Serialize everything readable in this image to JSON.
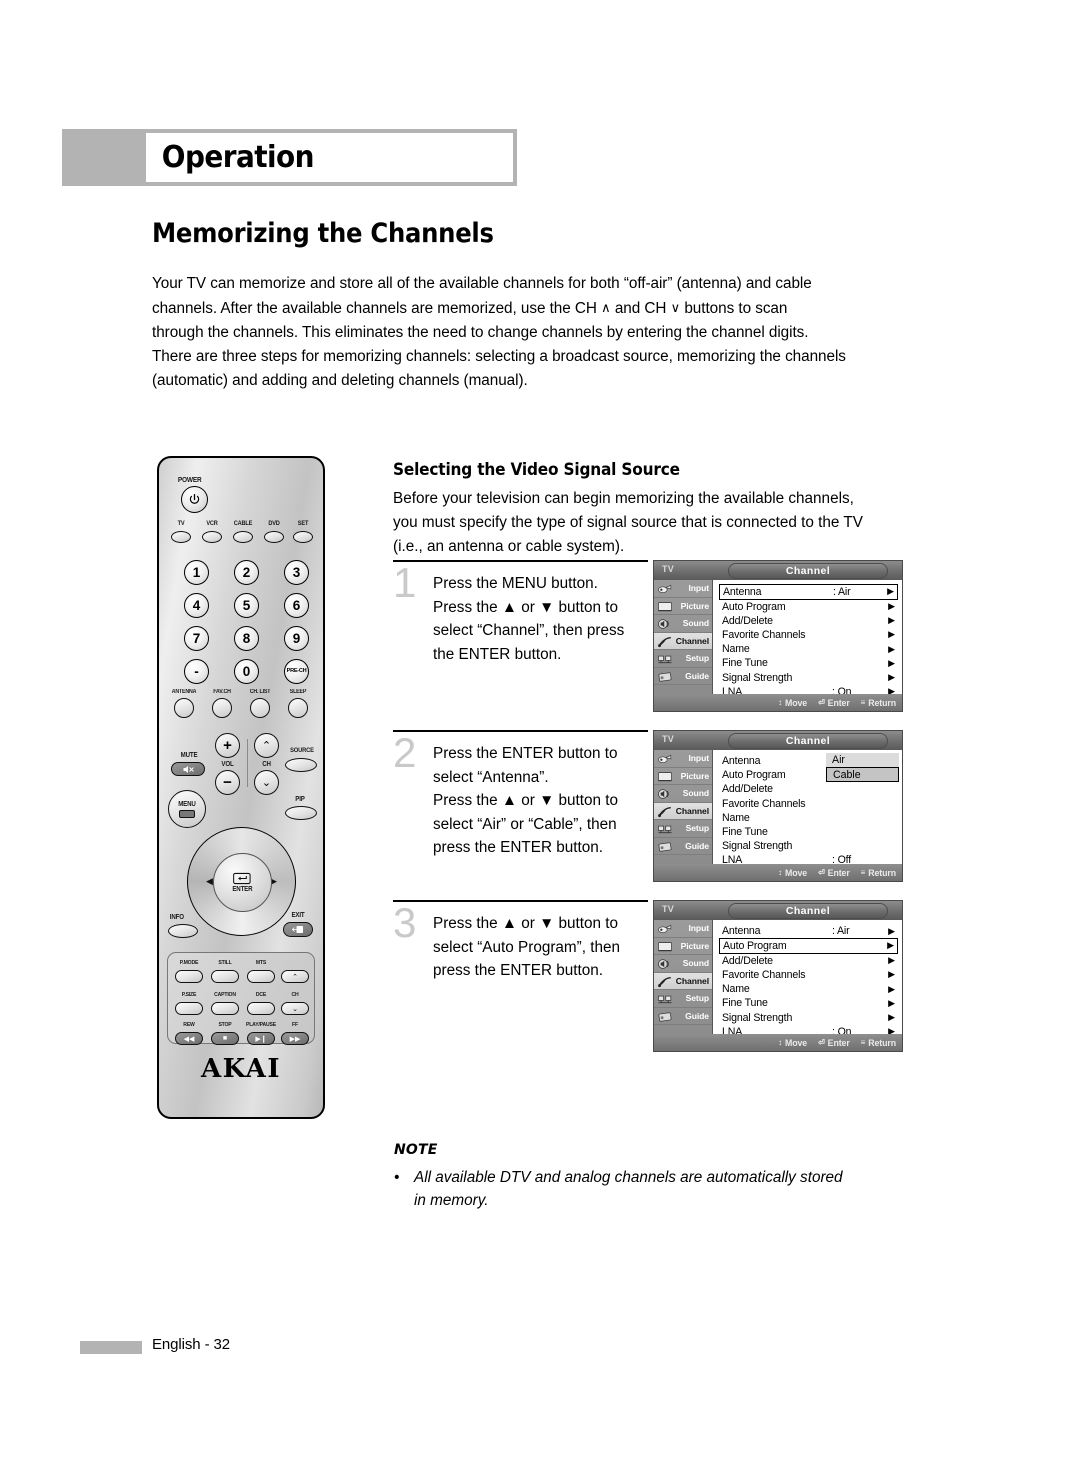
{
  "header": {
    "title": "Operation"
  },
  "page_title": "Memorizing the Channels",
  "intro": {
    "l1": "Your TV can memorize and store all of the available channels for both “off-air” (antenna) and cable",
    "l2a": "channels. After the available channels are memorized, use the CH",
    "l2b": "and CH",
    "l2c": "buttons to scan",
    "l3": "through the channels. This eliminates the need to change channels by entering the channel digits.",
    "l4": "There are three steps for memorizing channels: selecting a broadcast source, memorizing the channels",
    "l5": "(automatic) and adding and deleting channels (manual).",
    "ch_up_glyph": "∧",
    "ch_down_glyph": "∨"
  },
  "section": {
    "title": "Selecting the Video Signal Source",
    "lead_l1": "Before your television can begin memorizing the available channels,",
    "lead_l2": "you must specify the type of signal source that is connected to the TV",
    "lead_l3": "(i.e., an antenna or cable system)."
  },
  "steps": [
    {
      "number": "1",
      "lines": [
        "Press the MENU button.",
        "Press the ▲ or ▼ button to",
        "select “Channel”, then press",
        "the ENTER button."
      ]
    },
    {
      "number": "2",
      "lines": [
        "Press the ENTER button to",
        "select “Antenna”.",
        "Press the ▲ or ▼ button to",
        "select “Air” or “Cable”, then",
        "press the ENTER button."
      ]
    },
    {
      "number": "3",
      "lines": [
        "Press the ▲ or ▼ button to",
        "select “Auto Program”, then",
        "press the ENTER button."
      ]
    }
  ],
  "osd": {
    "source_label": "TV",
    "menu_title": "Channel",
    "sidebar": [
      {
        "label": "Input",
        "icon": "input-icon",
        "selected": false
      },
      {
        "label": "Picture",
        "icon": "picture-icon",
        "selected": false
      },
      {
        "label": "Sound",
        "icon": "sound-icon",
        "selected": false
      },
      {
        "label": "Channel",
        "icon": "channel-icon",
        "selected": true
      },
      {
        "label": "Setup",
        "icon": "setup-icon",
        "selected": false
      },
      {
        "label": "Guide",
        "icon": "guide-icon",
        "selected": false
      }
    ],
    "hints": [
      {
        "glyph": "↕",
        "label": "Move",
        "icon": "updown-arrows-icon"
      },
      {
        "glyph": "⏎",
        "label": "Enter",
        "icon": "enter-key-icon"
      },
      {
        "glyph": "≡",
        "label": "Return",
        "icon": "menu-key-icon"
      }
    ],
    "arrow_glyph": "▶",
    "screens": [
      {
        "id": "screen-1",
        "rows": [
          {
            "name": "Antenna",
            "value": ": Air",
            "arrow": true,
            "highlight": true
          },
          {
            "name": "Auto Program",
            "value": "",
            "arrow": true,
            "highlight": false
          },
          {
            "name": "Add/Delete",
            "value": "",
            "arrow": true,
            "highlight": false
          },
          {
            "name": "Favorite Channels",
            "value": "",
            "arrow": true,
            "highlight": false
          },
          {
            "name": "Name",
            "value": "",
            "arrow": true,
            "highlight": false
          },
          {
            "name": "Fine Tune",
            "value": "",
            "arrow": true,
            "highlight": false
          },
          {
            "name": "Signal Strength",
            "value": "",
            "arrow": true,
            "highlight": false
          },
          {
            "name": "LNA",
            "value": ": On",
            "arrow": true,
            "highlight": false
          }
        ],
        "popup": null
      },
      {
        "id": "screen-2",
        "rows": [
          {
            "name": "Antenna",
            "value": "",
            "arrow": false,
            "highlight": false
          },
          {
            "name": "Auto Program",
            "value": "",
            "arrow": false,
            "highlight": false
          },
          {
            "name": "Add/Delete",
            "value": "",
            "arrow": false,
            "highlight": false
          },
          {
            "name": "Favorite Channels",
            "value": "",
            "arrow": false,
            "highlight": false
          },
          {
            "name": "Name",
            "value": "",
            "arrow": false,
            "highlight": false
          },
          {
            "name": "Fine Tune",
            "value": "",
            "arrow": false,
            "highlight": false
          },
          {
            "name": "Signal Strength",
            "value": "",
            "arrow": false,
            "highlight": false
          },
          {
            "name": "LNA",
            "value": ": Off",
            "arrow": false,
            "highlight": false
          }
        ],
        "popup": {
          "options": [
            "Air",
            "Cable"
          ],
          "selected": "Cable"
        }
      },
      {
        "id": "screen-3",
        "rows": [
          {
            "name": "Antenna",
            "value": ": Air",
            "arrow": true,
            "highlight": false
          },
          {
            "name": "Auto Program",
            "value": "",
            "arrow": true,
            "highlight": true
          },
          {
            "name": "Add/Delete",
            "value": "",
            "arrow": true,
            "highlight": false
          },
          {
            "name": "Favorite Channels",
            "value": "",
            "arrow": true,
            "highlight": false
          },
          {
            "name": "Name",
            "value": "",
            "arrow": true,
            "highlight": false
          },
          {
            "name": "Fine Tune",
            "value": "",
            "arrow": true,
            "highlight": false
          },
          {
            "name": "Signal Strength",
            "value": "",
            "arrow": true,
            "highlight": false
          },
          {
            "name": "LNA",
            "value": ": On",
            "arrow": true,
            "highlight": false
          }
        ],
        "popup": null
      }
    ]
  },
  "remote": {
    "brand": "AKAI",
    "power_label": "POWER",
    "device_buttons": [
      "TV",
      "VCR",
      "CABLE",
      "DVD",
      "SET"
    ],
    "keypad": [
      "1",
      "2",
      "3",
      "4",
      "5",
      "6",
      "7",
      "8",
      "9",
      "-",
      "0",
      "PRE-CH"
    ],
    "function_row": [
      "ANTENNA",
      "FAV.CH",
      "CH. LIST",
      "SLEEP"
    ],
    "mute_label": "MUTE",
    "vol_label": "VOL",
    "ch_label": "CH",
    "source_label": "SOURCE",
    "menu_label": "MENU",
    "pip_label": "PIP",
    "enter_label": "ENTER",
    "info_label": "INFO",
    "exit_label": "EXIT",
    "media_labels": [
      "P.MODE",
      "STILL",
      "MTS",
      "P.SIZE",
      "CAPTION",
      "DCE",
      "CH",
      "REW",
      "STOP",
      "PLAY/PAUSE",
      "FF"
    ]
  },
  "note": {
    "title": "NOTE",
    "bullet": "•",
    "line1": "All available DTV and analog channels are automatically stored",
    "line2": "in memory."
  },
  "footer": {
    "page": "English - 32"
  },
  "colors": {
    "accent_gray": "#b3b3b3",
    "step_number": "#c9c9c9",
    "osd_panel": "#d9d9d9",
    "osd_body": "#ffffff"
  }
}
